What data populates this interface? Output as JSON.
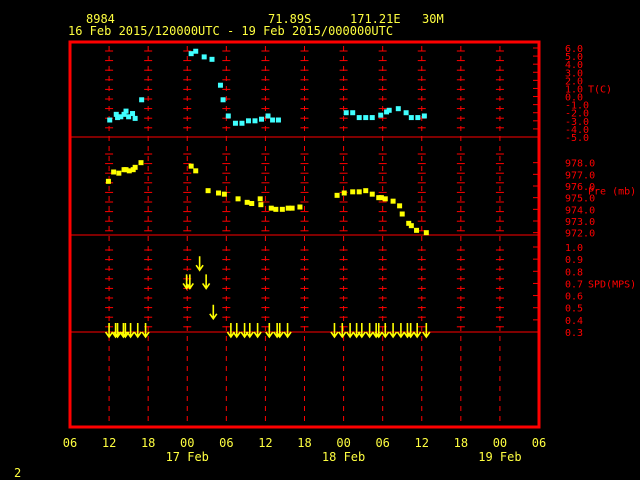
{
  "header": {
    "station_id": "8984",
    "lat": "71.89S",
    "lon": "171.21E",
    "height": "30M",
    "period": "16 Feb 2015/120000UTC - 19 Feb 2015/000000UTC"
  },
  "footer_number": "2",
  "colors": {
    "frame": "#ff0000",
    "header_text": "#ffff40",
    "temperature": "#40ffff",
    "pressure": "#ffff00",
    "wind": "#ffff00"
  },
  "chart_data": {
    "type": "scatter",
    "x_axis": {
      "unit": "hours since 16 Feb 06 UTC",
      "range": [
        0,
        72
      ],
      "tick_labels": [
        "06",
        "12",
        "18",
        "00",
        "06",
        "12",
        "18",
        "00",
        "06",
        "12",
        "18",
        "00",
        "06"
      ],
      "date_labels": [
        {
          "label": "17 Feb",
          "hour": 18
        },
        {
          "label": "18 Feb",
          "hour": 42
        },
        {
          "label": "19 Feb",
          "hour": 66
        }
      ]
    },
    "panels": [
      {
        "name": "temperature",
        "label": "T(C)",
        "range": [
          -5,
          6
        ],
        "tick_labels": [
          "6.0",
          "5.0",
          "4.0",
          "3.0",
          "2.0",
          "1.0",
          "0.0",
          "-1.0",
          "-2.0",
          "-3.0",
          "-4.0",
          "-5.0"
        ],
        "marker": "square",
        "color": "#40ffff",
        "points": [
          [
            6.1,
            -2.9
          ],
          [
            7.1,
            -2.2
          ],
          [
            7.3,
            -2.6
          ],
          [
            7.8,
            -2.5
          ],
          [
            8.3,
            -2.2
          ],
          [
            8.6,
            -1.8
          ],
          [
            9.0,
            -2.5
          ],
          [
            9.6,
            -2.1
          ],
          [
            10.0,
            -2.7
          ],
          [
            11.0,
            -0.4
          ],
          [
            18.6,
            5.3
          ],
          [
            19.3,
            5.6
          ],
          [
            20.6,
            4.9
          ],
          [
            21.8,
            4.6
          ],
          [
            23.1,
            1.4
          ],
          [
            23.5,
            -0.4
          ],
          [
            24.3,
            -2.4
          ],
          [
            25.4,
            -3.3
          ],
          [
            26.4,
            -3.3
          ],
          [
            27.4,
            -3.0
          ],
          [
            28.4,
            -3.0
          ],
          [
            29.4,
            -2.8
          ],
          [
            30.4,
            -2.4
          ],
          [
            31.1,
            -2.9
          ],
          [
            32.0,
            -2.9
          ],
          [
            42.4,
            -2.0
          ],
          [
            43.4,
            -2.0
          ],
          [
            44.4,
            -2.6
          ],
          [
            45.4,
            -2.6
          ],
          [
            46.4,
            -2.6
          ],
          [
            47.7,
            -2.3
          ],
          [
            48.6,
            -1.9
          ],
          [
            49.0,
            -1.7
          ],
          [
            50.4,
            -1.5
          ],
          [
            51.6,
            -2.0
          ],
          [
            52.4,
            -2.6
          ],
          [
            53.4,
            -2.6
          ],
          [
            54.4,
            -2.4
          ]
        ]
      },
      {
        "name": "pressure",
        "label": "Pre (mb)",
        "range": [
          971.8,
          979.0
        ],
        "tick_labels": [
          "978.0",
          "977.0",
          "976.0",
          "975.0",
          "974.0",
          "973.0",
          "972.0"
        ],
        "marker": "square",
        "color": "#ffff00",
        "points": [
          [
            5.9,
            976.4
          ],
          [
            6.7,
            977.2
          ],
          [
            7.5,
            977.1
          ],
          [
            8.3,
            977.4
          ],
          [
            8.6,
            977.4
          ],
          [
            9.1,
            977.3
          ],
          [
            9.7,
            977.4
          ],
          [
            10.0,
            977.6
          ],
          [
            10.9,
            978.0
          ],
          [
            18.6,
            977.7
          ],
          [
            19.3,
            977.3
          ],
          [
            21.2,
            975.6
          ],
          [
            22.8,
            975.4
          ],
          [
            23.7,
            975.3
          ],
          [
            25.8,
            974.9
          ],
          [
            27.2,
            974.6
          ],
          [
            27.9,
            974.5
          ],
          [
            29.2,
            974.9
          ],
          [
            29.3,
            974.4
          ],
          [
            30.9,
            974.1
          ],
          [
            31.6,
            974.0
          ],
          [
            32.6,
            974.0
          ],
          [
            33.5,
            974.1
          ],
          [
            34.1,
            974.1
          ],
          [
            35.3,
            974.2
          ],
          [
            41.0,
            975.2
          ],
          [
            42.1,
            975.4
          ],
          [
            43.4,
            975.5
          ],
          [
            44.4,
            975.5
          ],
          [
            45.4,
            975.6
          ],
          [
            46.4,
            975.3
          ],
          [
            47.4,
            975.0
          ],
          [
            47.8,
            975.0
          ],
          [
            48.4,
            974.9
          ],
          [
            49.6,
            974.7
          ],
          [
            50.6,
            974.3
          ],
          [
            51.0,
            973.6
          ],
          [
            52.0,
            972.8
          ],
          [
            52.4,
            972.6
          ],
          [
            53.2,
            972.2
          ],
          [
            54.7,
            972.0
          ]
        ]
      },
      {
        "name": "wind",
        "label": "SPD(MPS)",
        "range": [
          0.3,
          1.0
        ],
        "tick_labels": [
          "1.0",
          "0.9",
          "0.8",
          "0.7",
          "0.6",
          "0.5",
          "0.4",
          "0.3"
        ],
        "marker": "arrow",
        "color": "#ffff00",
        "points": [
          [
            6.0,
            0.3
          ],
          [
            7.0,
            0.3
          ],
          [
            7.3,
            0.3
          ],
          [
            8.2,
            0.3
          ],
          [
            8.5,
            0.3
          ],
          [
            9.3,
            0.3
          ],
          [
            10.4,
            0.3
          ],
          [
            11.6,
            0.3
          ],
          [
            17.9,
            0.7
          ],
          [
            18.4,
            0.7
          ],
          [
            19.9,
            0.85
          ],
          [
            20.9,
            0.7
          ],
          [
            22.0,
            0.45
          ],
          [
            24.7,
            0.3
          ],
          [
            25.6,
            0.3
          ],
          [
            26.8,
            0.3
          ],
          [
            27.6,
            0.3
          ],
          [
            28.8,
            0.3
          ],
          [
            30.6,
            0.3
          ],
          [
            31.8,
            0.3
          ],
          [
            32.2,
            0.3
          ],
          [
            33.4,
            0.3
          ],
          [
            40.6,
            0.3
          ],
          [
            41.8,
            0.3
          ],
          [
            43.0,
            0.3
          ],
          [
            44.0,
            0.3
          ],
          [
            44.8,
            0.3
          ],
          [
            46.0,
            0.3
          ],
          [
            47.0,
            0.3
          ],
          [
            47.4,
            0.3
          ],
          [
            48.4,
            0.3
          ],
          [
            49.6,
            0.3
          ],
          [
            50.8,
            0.3
          ],
          [
            51.8,
            0.3
          ],
          [
            52.3,
            0.3
          ],
          [
            53.3,
            0.3
          ],
          [
            54.7,
            0.3
          ]
        ]
      }
    ]
  }
}
